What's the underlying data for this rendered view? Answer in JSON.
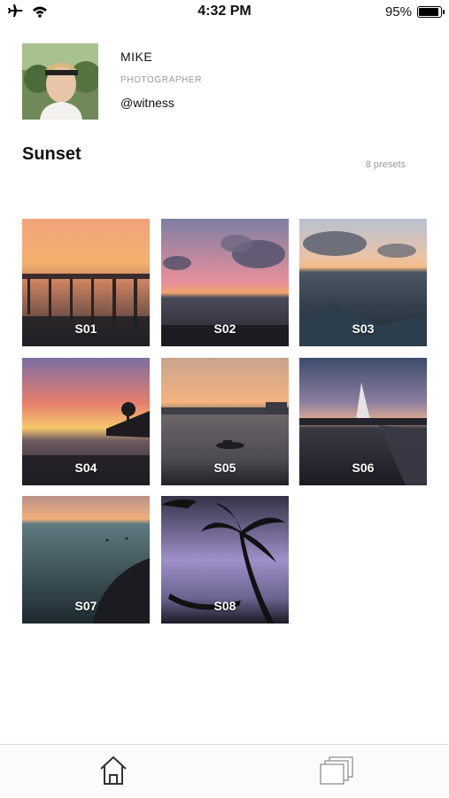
{
  "status_bar": {
    "time": "4:32 PM",
    "battery": "95%",
    "battery_level": 0.95
  },
  "profile": {
    "name": "MIKE",
    "role": "PHOTOGRAPHER",
    "handle": "@witness"
  },
  "collection": {
    "title": "Sunset",
    "count_label": "8 presets"
  },
  "presets": [
    {
      "label": "S01"
    },
    {
      "label": "S02"
    },
    {
      "label": "S03"
    },
    {
      "label": "S04"
    },
    {
      "label": "S05"
    },
    {
      "label": "S06"
    },
    {
      "label": "S07"
    },
    {
      "label": "S08"
    }
  ],
  "tabbar": {
    "items": [
      "home-icon",
      "stack-icon"
    ]
  }
}
